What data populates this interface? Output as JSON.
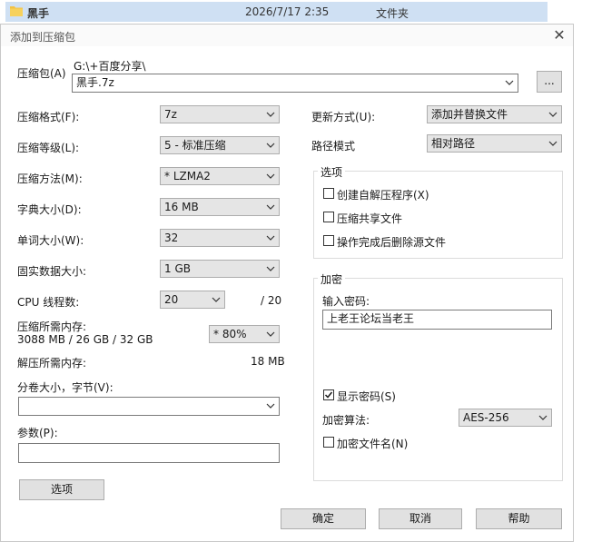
{
  "background": {
    "folder_name": "黑手",
    "date": "2026/7/17 2:35",
    "type": "文件夹"
  },
  "dialog": {
    "title": "添加到压缩包",
    "close_glyph": "✕"
  },
  "archive": {
    "label": "压缩包(A)",
    "path": "G:\\+百度分享\\",
    "filename": "黑手.7z",
    "browse_label": "..."
  },
  "left": {
    "format": {
      "label": "压缩格式(F):",
      "value": "7z"
    },
    "level": {
      "label": "压缩等级(L):",
      "value": "5 - 标准压缩"
    },
    "method": {
      "label": "压缩方法(M):",
      "value": "*  LZMA2"
    },
    "dict": {
      "label": "字典大小(D):",
      "value": "16 MB"
    },
    "word": {
      "label": "单词大小(W):",
      "value": "32"
    },
    "solid": {
      "label": "固实数据大小:",
      "value": "1 GB"
    },
    "cpu": {
      "label": "CPU 线程数:",
      "value": "20",
      "max": "/ 20"
    },
    "mem_compress": {
      "label": "压缩所需内存:",
      "detail": "3088 MB / 26 GB / 32 GB",
      "value": "* 80%"
    },
    "mem_decompress": {
      "label": "解压所需内存:",
      "value": "18 MB"
    },
    "split": {
      "label": "分卷大小，字节(V):",
      "value": ""
    },
    "params": {
      "label": "参数(P):",
      "value": ""
    },
    "options_button": "选项"
  },
  "right": {
    "update": {
      "label": "更新方式(U):",
      "value": "添加并替换文件"
    },
    "path_mode": {
      "label": "路径模式",
      "value": "相对路径"
    },
    "options_group": {
      "title": "选项",
      "sfx": {
        "label": "创建自解压程序(X)",
        "checked": false
      },
      "shared": {
        "label": "压缩共享文件",
        "checked": false
      },
      "delete": {
        "label": "操作完成后删除源文件",
        "checked": false
      }
    },
    "encryption": {
      "title": "加密",
      "password_label": "输入密码:",
      "password_value": "上老王论坛当老王",
      "show_password": {
        "label": "显示密码(S)",
        "checked": true
      },
      "method_label": "加密算法:",
      "method_value": "AES-256",
      "encrypt_names": {
        "label": "加密文件名(N)",
        "checked": false
      }
    }
  },
  "footer": {
    "ok": "确定",
    "cancel": "取消",
    "help": "帮助"
  }
}
